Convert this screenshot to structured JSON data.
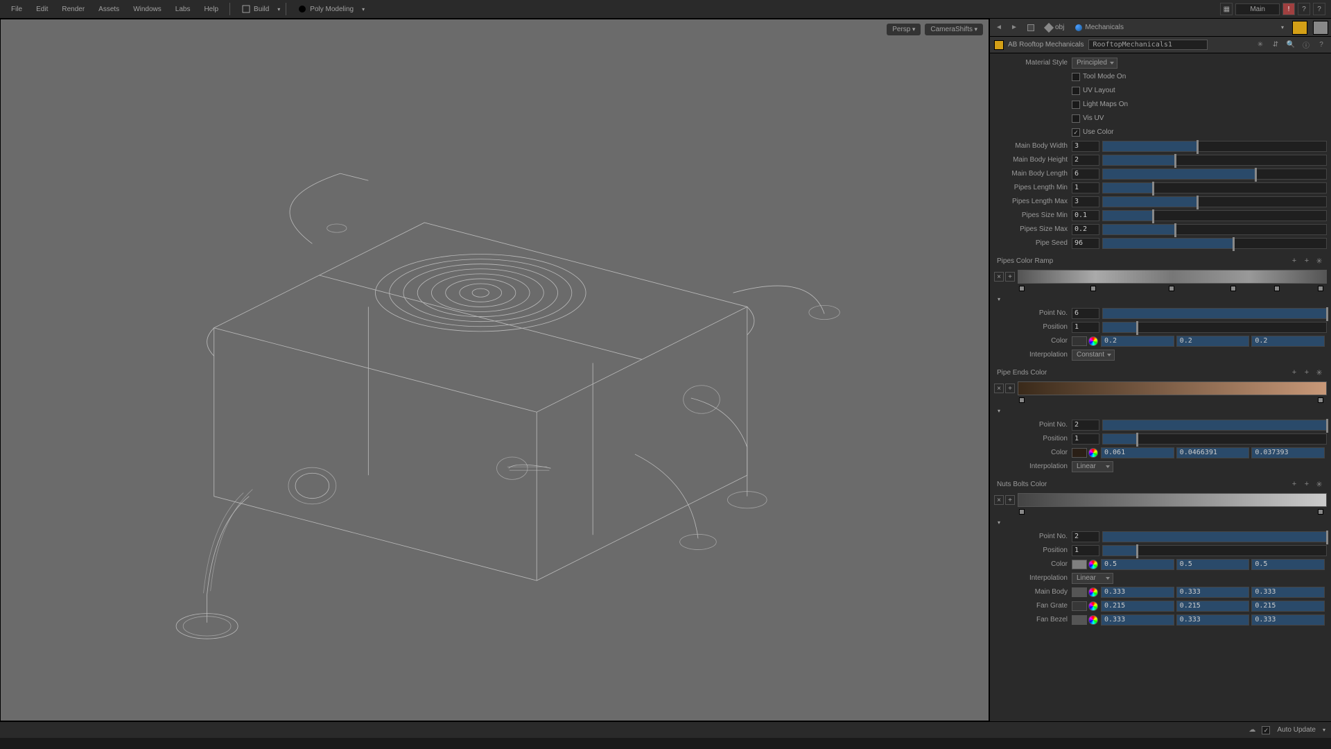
{
  "top_menu": {
    "items": [
      "File",
      "Edit",
      "Render",
      "Assets",
      "Windows",
      "Labs",
      "Help"
    ],
    "shelf_build": "Build",
    "shelf_poly": "Poly Modeling",
    "desktop": "Main"
  },
  "viewport": {
    "camera": "Persp",
    "preset": "CameraShifts"
  },
  "path_bar": {
    "obj": "obj",
    "node": "Mechanicals"
  },
  "obj_header": {
    "asset": "AB Rooftop Mechanicals",
    "node": "RooftopMechanicals1"
  },
  "params": {
    "material_style_lbl": "Material Style",
    "material_style_val": "Principled",
    "tool_mode": "Tool Mode On",
    "uv_layout": "UV Layout",
    "light_maps": "Light Maps On",
    "vis_uv": "Vis UV",
    "use_color": "Use Color",
    "main_body_width_lbl": "Main Body Width",
    "main_body_width_val": "3",
    "main_body_height_lbl": "Main Body Height",
    "main_body_height_val": "2",
    "main_body_length_lbl": "Main Body Length",
    "main_body_length_val": "6",
    "pipes_len_min_lbl": "Pipes Length Min",
    "pipes_len_min_val": "1",
    "pipes_len_max_lbl": "Pipes Length Max",
    "pipes_len_max_val": "3",
    "pipes_size_min_lbl": "Pipes Size Min",
    "pipes_size_min_val": "0.1",
    "pipes_size_max_lbl": "Pipes Size Max",
    "pipes_size_max_val": "0.2",
    "pipe_seed_lbl": "Pipe Seed",
    "pipe_seed_val": "96"
  },
  "pipes_color_ramp": {
    "title": "Pipes Color Ramp",
    "point_no_lbl": "Point No.",
    "point_no_val": "6",
    "position_lbl": "Position",
    "position_val": "1",
    "color_lbl": "Color",
    "r": "0.2",
    "g": "0.2",
    "b": "0.2",
    "interp_lbl": "Interpolation",
    "interp_val": "Constant"
  },
  "pipe_ends_color": {
    "title": "Pipe Ends Color",
    "point_no_lbl": "Point No.",
    "point_no_val": "2",
    "position_lbl": "Position",
    "position_val": "1",
    "color_lbl": "Color",
    "r": "0.061",
    "g": "0.0466391",
    "b": "0.037393",
    "interp_lbl": "Interpolation",
    "interp_val": "Linear"
  },
  "nuts_bolts_color": {
    "title": "Nuts Bolts Color",
    "point_no_lbl": "Point No.",
    "point_no_val": "2",
    "position_lbl": "Position",
    "position_val": "1",
    "color_lbl": "Color",
    "r": "0.5",
    "g": "0.5",
    "b": "0.5",
    "interp_lbl": "Interpolation",
    "interp_val": "Linear"
  },
  "extra_colors": {
    "main_body_lbl": "Main Body",
    "main_body_r": "0.333",
    "main_body_g": "0.333",
    "main_body_b": "0.333",
    "fan_grate_lbl": "Fan Grate",
    "fan_grate_r": "0.215",
    "fan_grate_g": "0.215",
    "fan_grate_b": "0.215",
    "fan_bezel_lbl": "Fan Bezel",
    "fan_bezel_r": "0.333",
    "fan_bezel_g": "0.333",
    "fan_bezel_b": "0.333"
  },
  "status": {
    "auto_update": "Auto Update"
  }
}
